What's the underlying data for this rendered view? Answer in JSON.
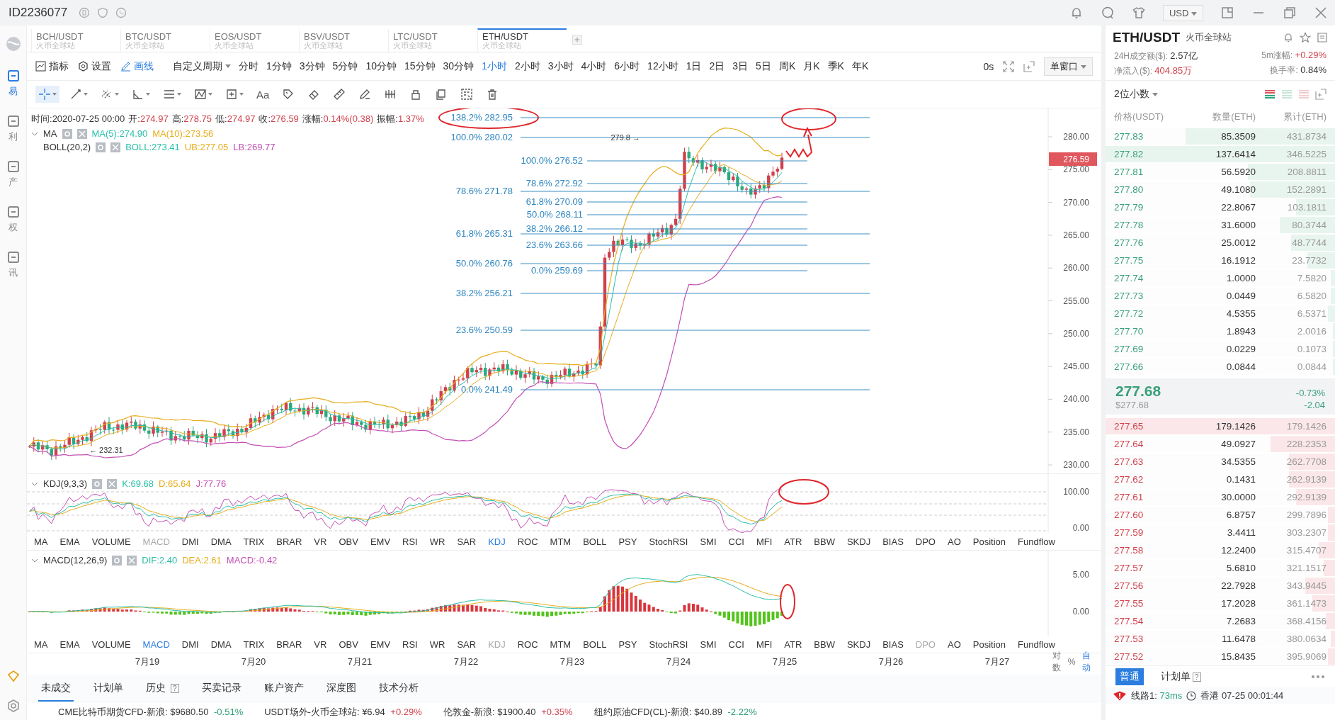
{
  "window": {
    "account_id": "ID2236077",
    "currency": "USD"
  },
  "sidebar": {
    "items": [
      {
        "label": "易",
        "selected": true
      },
      {
        "label": "利",
        "selected": false
      },
      {
        "label": "产",
        "selected": false
      },
      {
        "label": "权",
        "selected": false
      },
      {
        "label": "讯",
        "selected": false
      }
    ]
  },
  "market_tabs": [
    {
      "symbol": "BCH/USDT",
      "exchange": "火币全球站",
      "selected": false
    },
    {
      "symbol": "BTC/USDT",
      "exchange": "火币全球站",
      "selected": false
    },
    {
      "symbol": "EOS/USDT",
      "exchange": "火币全球站",
      "selected": false
    },
    {
      "symbol": "BSV/USDT",
      "exchange": "火币全球站",
      "selected": false
    },
    {
      "symbol": "LTC/USDT",
      "exchange": "火币全球站",
      "selected": false
    },
    {
      "symbol": "ETH/USDT",
      "exchange": "火币全球站",
      "selected": true
    }
  ],
  "toolbar": {
    "buttons": [
      {
        "label": "指标",
        "kind": "indicator",
        "selected": false
      },
      {
        "label": "设置",
        "kind": "settings",
        "selected": false
      },
      {
        "label": "画线",
        "kind": "draw",
        "selected": true
      }
    ],
    "custom_period": "自定义周期",
    "periods": [
      {
        "label": "分时",
        "selected": false
      },
      {
        "label": "1分钟",
        "selected": false
      },
      {
        "label": "3分钟",
        "selected": false
      },
      {
        "label": "5分钟",
        "selected": false
      },
      {
        "label": "10分钟",
        "selected": false
      },
      {
        "label": "15分钟",
        "selected": false
      },
      {
        "label": "30分钟",
        "selected": false
      },
      {
        "label": "1小时",
        "selected": true
      },
      {
        "label": "2小时",
        "selected": false
      },
      {
        "label": "3小时",
        "selected": false
      },
      {
        "label": "4小时",
        "selected": false
      },
      {
        "label": "6小时",
        "selected": false
      },
      {
        "label": "12小时",
        "selected": false
      },
      {
        "label": "1日",
        "selected": false
      },
      {
        "label": "2日",
        "selected": false
      },
      {
        "label": "3日",
        "selected": false
      },
      {
        "label": "5日",
        "selected": false
      },
      {
        "label": "周K",
        "selected": false
      },
      {
        "label": "月K",
        "selected": false
      },
      {
        "label": "季K",
        "selected": false
      },
      {
        "label": "年K",
        "selected": false
      }
    ],
    "countdown": "0s",
    "window_mode": "单窗口"
  },
  "draw_tools": [
    {
      "kind": "crosshair",
      "selected": true,
      "menu": true
    },
    {
      "kind": "line",
      "selected": false,
      "menu": true
    },
    {
      "kind": "parallel",
      "selected": false,
      "menu": true
    },
    {
      "kind": "angle",
      "selected": false,
      "menu": true
    },
    {
      "kind": "lines",
      "selected": false,
      "menu": true
    },
    {
      "kind": "pattern",
      "selected": false,
      "menu": true
    },
    {
      "kind": "frame",
      "selected": false,
      "menu": true
    },
    {
      "kind": "text",
      "label": "Aa",
      "selected": false,
      "menu": false
    },
    {
      "kind": "tag",
      "selected": false,
      "menu": false
    },
    {
      "kind": "eraser",
      "selected": false,
      "menu": false
    },
    {
      "kind": "ruler",
      "selected": false,
      "menu": false
    },
    {
      "kind": "pen",
      "selected": false,
      "menu": false
    },
    {
      "kind": "bars",
      "selected": false,
      "menu": false
    },
    {
      "kind": "lock",
      "selected": false,
      "menu": false
    },
    {
      "kind": "copy",
      "selected": false,
      "menu": false
    },
    {
      "kind": "capture",
      "selected": false,
      "menu": false
    },
    {
      "kind": "trash",
      "selected": false,
      "menu": false
    }
  ],
  "chart": {
    "info": [
      {
        "label": "时间:",
        "value": "2020-07-25 00:00",
        "color": "#333333"
      },
      {
        "label": "开:",
        "value": "274.97",
        "color": "#d0414c"
      },
      {
        "label": "高:",
        "value": "278.75",
        "color": "#d0414c"
      },
      {
        "label": "低:",
        "value": "274.97",
        "color": "#d0414c"
      },
      {
        "label": "收:",
        "value": "276.59",
        "color": "#d0414c"
      },
      {
        "label": "涨幅:",
        "value": "0.14%(0.38)",
        "color": "#d0414c"
      },
      {
        "label": "振幅:",
        "value": "1.37%",
        "color": "#d0414c"
      }
    ],
    "ma_legend": {
      "name": "MA",
      "values": [
        {
          "text": "MA(5):274.90",
          "color": "#2bbfa8"
        },
        {
          "text": "MA(10):273.56",
          "color": "#e6ad1c"
        }
      ]
    },
    "boll_legend": {
      "name": "BOLL(20,2)",
      "values": [
        {
          "text": "BOLL:273.41",
          "color": "#2bbfa8"
        },
        {
          "text": "UB:277.05",
          "color": "#e6ad1c"
        },
        {
          "text": "LB:269.77",
          "color": "#c34fb4"
        }
      ]
    },
    "fib_outer": [
      "138.2% 282.95",
      "100.0% 280.02",
      "78.6% 271.78",
      "61.8% 265.31",
      "50.0% 260.76",
      "38.2% 256.21",
      "23.6% 250.59",
      "0.0% 241.49"
    ],
    "fib_inner": [
      "100.0% 276.52",
      "78.6% 272.92",
      "61.8% 270.09",
      "50.0% 268.11",
      "38.2% 266.12",
      "23.6% 263.66",
      "0.0% 259.69"
    ],
    "high_marker": "279.8 →",
    "low_marker": "← 232.31",
    "price_axis": [
      "280.00",
      "275.00",
      "270.00",
      "265.00",
      "260.00",
      "255.00",
      "250.00",
      "245.00",
      "240.00",
      "235.00",
      "230.00"
    ],
    "last_price": "276.59"
  },
  "kdj": {
    "title": "KDJ(9,3,3)",
    "values": [
      {
        "text": "K:69.68",
        "color": "#2bbfa8"
      },
      {
        "text": "D:65.64",
        "color": "#e6ad1c"
      },
      {
        "text": "J:77.76",
        "color": "#c34fb4"
      }
    ],
    "axis": [
      "100.00",
      "0.00"
    ]
  },
  "indicator_tabs_kdj": [
    {
      "label": "MA",
      "selected": false,
      "dimmed": false
    },
    {
      "label": "EMA",
      "selected": false,
      "dimmed": false
    },
    {
      "label": "VOLUME",
      "selected": false,
      "dimmed": false
    },
    {
      "label": "MACD",
      "selected": false,
      "dimmed": true
    },
    {
      "label": "DMI",
      "selected": false,
      "dimmed": false
    },
    {
      "label": "DMA",
      "selected": false,
      "dimmed": false
    },
    {
      "label": "TRIX",
      "selected": false,
      "dimmed": false
    },
    {
      "label": "BRAR",
      "selected": false,
      "dimmed": false
    },
    {
      "label": "VR",
      "selected": false,
      "dimmed": false
    },
    {
      "label": "OBV",
      "selected": false,
      "dimmed": false
    },
    {
      "label": "EMV",
      "selected": false,
      "dimmed": false
    },
    {
      "label": "RSI",
      "selected": false,
      "dimmed": false
    },
    {
      "label": "WR",
      "selected": false,
      "dimmed": false
    },
    {
      "label": "SAR",
      "selected": false,
      "dimmed": false
    },
    {
      "label": "KDJ",
      "selected": true,
      "dimmed": false
    },
    {
      "label": "ROC",
      "selected": false,
      "dimmed": false
    },
    {
      "label": "MTM",
      "selected": false,
      "dimmed": false
    },
    {
      "label": "BOLL",
      "selected": false,
      "dimmed": false
    },
    {
      "label": "PSY",
      "selected": false,
      "dimmed": false
    },
    {
      "label": "StochRSI",
      "selected": false,
      "dimmed": false
    },
    {
      "label": "SMI",
      "selected": false,
      "dimmed": false
    },
    {
      "label": "CCI",
      "selected": false,
      "dimmed": false
    },
    {
      "label": "MFI",
      "selected": false,
      "dimmed": false
    },
    {
      "label": "ATR",
      "selected": false,
      "dimmed": false
    },
    {
      "label": "BBW",
      "selected": false,
      "dimmed": false
    },
    {
      "label": "SKDJ",
      "selected": false,
      "dimmed": false
    },
    {
      "label": "BIAS",
      "selected": false,
      "dimmed": false
    },
    {
      "label": "DPO",
      "selected": false,
      "dimmed": false
    },
    {
      "label": "AO",
      "selected": false,
      "dimmed": false
    },
    {
      "label": "Position",
      "selected": false,
      "dimmed": false
    },
    {
      "label": "Fundflow",
      "selected": false,
      "dimmed": false
    }
  ],
  "macd": {
    "title": "MACD(12,26,9)",
    "values": [
      {
        "text": "DIF:2.40",
        "color": "#2bbfa8"
      },
      {
        "text": "DEA:2.61",
        "color": "#e6ad1c"
      },
      {
        "text": "MACD:-0.42",
        "color": "#c34fb4"
      }
    ],
    "axis": [
      "5.00",
      "0.00"
    ]
  },
  "indicator_tabs_macd": [
    {
      "label": "MA",
      "selected": false,
      "dimmed": false
    },
    {
      "label": "EMA",
      "selected": false,
      "dimmed": false
    },
    {
      "label": "VOLUME",
      "selected": false,
      "dimmed": false
    },
    {
      "label": "MACD",
      "selected": true,
      "dimmed": false
    },
    {
      "label": "DMI",
      "selected": false,
      "dimmed": false
    },
    {
      "label": "DMA",
      "selected": false,
      "dimmed": false
    },
    {
      "label": "TRIX",
      "selected": false,
      "dimmed": false
    },
    {
      "label": "BRAR",
      "selected": false,
      "dimmed": false
    },
    {
      "label": "VR",
      "selected": false,
      "dimmed": false
    },
    {
      "label": "OBV",
      "selected": false,
      "dimmed": false
    },
    {
      "label": "EMV",
      "selected": false,
      "dimmed": false
    },
    {
      "label": "RSI",
      "selected": false,
      "dimmed": false
    },
    {
      "label": "WR",
      "selected": false,
      "dimmed": false
    },
    {
      "label": "SAR",
      "selected": false,
      "dimmed": false
    },
    {
      "label": "KDJ",
      "selected": false,
      "dimmed": true
    },
    {
      "label": "ROC",
      "selected": false,
      "dimmed": false
    },
    {
      "label": "MTM",
      "selected": false,
      "dimmed": false
    },
    {
      "label": "BOLL",
      "selected": false,
      "dimmed": false
    },
    {
      "label": "PSY",
      "selected": false,
      "dimmed": false
    },
    {
      "label": "StochRSI",
      "selected": false,
      "dimmed": false
    },
    {
      "label": "SMI",
      "selected": false,
      "dimmed": false
    },
    {
      "label": "CCI",
      "selected": false,
      "dimmed": false
    },
    {
      "label": "MFI",
      "selected": false,
      "dimmed": false
    },
    {
      "label": "ATR",
      "selected": false,
      "dimmed": false
    },
    {
      "label": "BBW",
      "selected": false,
      "dimmed": false
    },
    {
      "label": "SKDJ",
      "selected": false,
      "dimmed": false
    },
    {
      "label": "BIAS",
      "selected": false,
      "dimmed": false
    },
    {
      "label": "DPO",
      "selected": false,
      "dimmed": true
    },
    {
      "label": "AO",
      "selected": false,
      "dimmed": false
    },
    {
      "label": "Position",
      "selected": false,
      "dimmed": false
    },
    {
      "label": "Fundflow",
      "selected": false,
      "dimmed": false
    }
  ],
  "date_axis": [
    "7月19",
    "7月20",
    "7月21",
    "7月22",
    "7月23",
    "7月24",
    "7月25",
    "7月26",
    "7月27"
  ],
  "axis_options": [
    {
      "label": "对数",
      "selected": false
    },
    {
      "label": "%",
      "selected": false
    },
    {
      "label": "自动",
      "selected": true
    }
  ],
  "bottom_tabs": [
    {
      "label": "未成交",
      "selected": true
    },
    {
      "label": "计划单",
      "selected": false
    },
    {
      "label": "历史",
      "selected": false,
      "badge": "?"
    },
    {
      "label": "买卖记录",
      "selected": false
    },
    {
      "label": "账户资产",
      "selected": false
    },
    {
      "label": "深度图",
      "selected": false
    },
    {
      "label": "技术分析",
      "selected": false
    }
  ],
  "tickers": [
    {
      "name": "CME比特币期货CFD-新浪:",
      "price": "$9680.50",
      "change": "-0.51%",
      "color": "#2a9d6f"
    },
    {
      "name": "USDT场外-火币全球站:",
      "price": "¥6.94",
      "change": "+0.29%",
      "color": "#d0414c"
    },
    {
      "name": "伦敦金-新浪:",
      "price": "$1900.40",
      "change": "+0.35%",
      "color": "#d0414c"
    },
    {
      "name": "纽约原油CFD(CL)-新浪:",
      "price": "$40.89",
      "change": "-2.22%",
      "color": "#2a9d6f"
    }
  ],
  "order_book": {
    "symbol": "ETH/USDT",
    "exchange": "火币全球站",
    "stats": [
      {
        "label": "24H成交额($):",
        "value": "2.57亿",
        "color": "#333333"
      },
      {
        "label": "5m涨幅:",
        "value": "+0.29%",
        "color": "#d0414c"
      },
      {
        "label": "净流入($):",
        "value": "404.85万",
        "color": "#d0414c"
      },
      {
        "label": "换手率:",
        "value": "0.84%",
        "color": "#333333"
      }
    ],
    "precision": "2位小数",
    "columns": [
      "价格(USDT)",
      "数量(ETH)",
      "累计(ETH)"
    ],
    "upper_rows": [
      {
        "price": "277.83",
        "amount": "85.3509",
        "total": "431.8734",
        "level": 0.65
      },
      {
        "price": "277.82",
        "amount": "137.6414",
        "total": "346.5225",
        "level": 1.0
      },
      {
        "price": "277.81",
        "amount": "56.5920",
        "total": "208.8811",
        "level": 0.38
      },
      {
        "price": "277.80",
        "amount": "49.1080",
        "total": "152.2891",
        "level": 0.37
      },
      {
        "price": "277.79",
        "amount": "22.8067",
        "total": "103.1811",
        "level": 0.17
      },
      {
        "price": "277.78",
        "amount": "31.6000",
        "total": "80.3744",
        "level": 0.24
      },
      {
        "price": "277.76",
        "amount": "25.0012",
        "total": "48.7744",
        "level": 0.19
      },
      {
        "price": "277.75",
        "amount": "16.1912",
        "total": "23.7732",
        "level": 0.12
      },
      {
        "price": "277.74",
        "amount": "1.0000",
        "total": "7.5820",
        "level": 0.02
      },
      {
        "price": "277.73",
        "amount": "0.0449",
        "total": "6.5820",
        "level": 0.02
      },
      {
        "price": "277.72",
        "amount": "4.5355",
        "total": "6.5371",
        "level": 0.03
      },
      {
        "price": "277.70",
        "amount": "1.8943",
        "total": "2.0016",
        "level": 0.01
      },
      {
        "price": "277.69",
        "amount": "0.0229",
        "total": "0.1073",
        "level": 0.01
      },
      {
        "price": "277.66",
        "amount": "0.0844",
        "total": "0.0844",
        "level": 0.01
      }
    ],
    "last": {
      "price": "277.68",
      "usd": "$277.68",
      "change_pct": "-0.73%",
      "change": "-2.04"
    },
    "lower_rows": [
      {
        "price": "277.65",
        "amount": "179.1426",
        "total": "179.1426",
        "level": 1.0
      },
      {
        "price": "277.64",
        "amount": "49.0927",
        "total": "228.2353",
        "level": 0.28
      },
      {
        "price": "277.63",
        "amount": "34.5355",
        "total": "262.7708",
        "level": 0.2
      },
      {
        "price": "277.62",
        "amount": "0.1431",
        "total": "262.9139",
        "level": 0.2
      },
      {
        "price": "277.61",
        "amount": "30.0000",
        "total": "292.9139",
        "level": 0.17
      },
      {
        "price": "277.60",
        "amount": "6.8757",
        "total": "299.7896",
        "level": 0.03
      },
      {
        "price": "277.59",
        "amount": "3.4411",
        "total": "303.2307",
        "level": 0.03
      },
      {
        "price": "277.58",
        "amount": "12.2400",
        "total": "315.4707",
        "level": 0.07
      },
      {
        "price": "277.57",
        "amount": "5.6810",
        "total": "321.1517",
        "level": 0.05
      },
      {
        "price": "277.56",
        "amount": "22.7928",
        "total": "343.9445",
        "level": 0.13
      },
      {
        "price": "277.55",
        "amount": "17.2028",
        "total": "361.1473",
        "level": 0.1
      },
      {
        "price": "277.54",
        "amount": "7.2683",
        "total": "368.4156",
        "level": 0.04
      },
      {
        "price": "277.53",
        "amount": "11.6478",
        "total": "380.0634",
        "level": 0.02
      },
      {
        "price": "277.52",
        "amount": "15.8435",
        "total": "395.9069",
        "level": 0.03
      }
    ],
    "order_tabs": [
      {
        "label": "普通",
        "selected": true
      },
      {
        "label": "计划单",
        "selected": false,
        "badge": "?"
      }
    ]
  },
  "status": {
    "line": "线路1:",
    "latency": "73ms",
    "clock": "香港 07-25 00:01:44"
  }
}
